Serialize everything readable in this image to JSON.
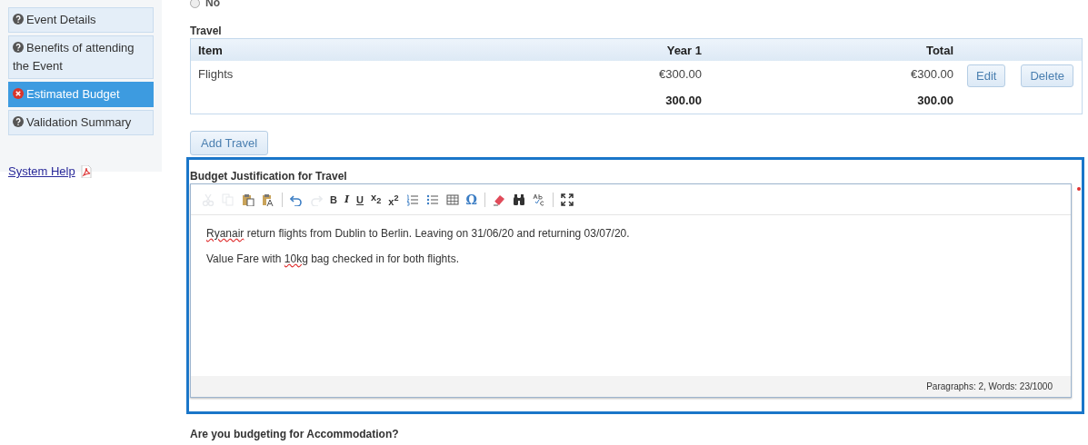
{
  "sidebar": {
    "items": [
      {
        "label": "Event Details",
        "kind": "help",
        "selected": false
      },
      {
        "label": "Benefits of attending the Event",
        "kind": "help",
        "selected": false
      },
      {
        "label": "Estimated Budget",
        "kind": "error",
        "selected": true
      },
      {
        "label": "Validation Summary",
        "kind": "help",
        "selected": false
      }
    ],
    "help_link": "System Help"
  },
  "radio": {
    "label": "No",
    "selected": false
  },
  "travel": {
    "title": "Travel",
    "columns": [
      "Item",
      "Year 1",
      "Total"
    ],
    "rows": [
      {
        "cells": [
          "Flights",
          "€300.00",
          "€300.00"
        ],
        "actions": [
          "Edit",
          "Delete"
        ]
      }
    ],
    "totals": [
      "300.00",
      "300.00"
    ],
    "add_button": "Add Travel"
  },
  "justification": {
    "label": "Budget Justification for Travel",
    "required": true,
    "toolbar": [
      {
        "kind": "cut",
        "disabled": true
      },
      {
        "kind": "copy",
        "disabled": true
      },
      {
        "kind": "paste",
        "disabled": false
      },
      {
        "kind": "paste-text",
        "disabled": false
      },
      {
        "kind": "sep"
      },
      {
        "kind": "undo",
        "disabled": false
      },
      {
        "kind": "redo",
        "disabled": true
      },
      {
        "kind": "bold",
        "label": "B"
      },
      {
        "kind": "italic",
        "label": "I"
      },
      {
        "kind": "underline",
        "label": "U"
      },
      {
        "kind": "subscript",
        "label": "x$_{2}$"
      },
      {
        "kind": "superscript",
        "label": "x$^{2}$"
      },
      {
        "kind": "numbered-list",
        "disabled": false
      },
      {
        "kind": "bullet-list",
        "disabled": false
      },
      {
        "kind": "table",
        "disabled": false
      },
      {
        "kind": "special-char",
        "label": "Ω"
      },
      {
        "kind": "sep"
      },
      {
        "kind": "eraser",
        "disabled": false
      },
      {
        "kind": "binoculars",
        "disabled": false
      },
      {
        "kind": "spellcheck",
        "disabled": false
      },
      {
        "kind": "sep"
      },
      {
        "kind": "maximize",
        "disabled": false
      }
    ],
    "paragraphs": [
      {
        "segments": [
          {
            "text": "Ryanair",
            "misspelled": true
          },
          {
            "text": " return flights from Dublin to Berlin. Leaving on 31/06/20 and returning 03/07/20.",
            "misspelled": false
          }
        ]
      },
      {
        "segments": [
          {
            "text": "Value Fare with ",
            "misspelled": false
          },
          {
            "text": "10kg",
            "misspelled": true
          },
          {
            "text": " bag checked in for both flights.",
            "misspelled": false
          }
        ]
      }
    ],
    "status": "Paragraphs: 2, Words: 23/1000"
  },
  "next_question": "Are you budgeting for Accommodation?"
}
